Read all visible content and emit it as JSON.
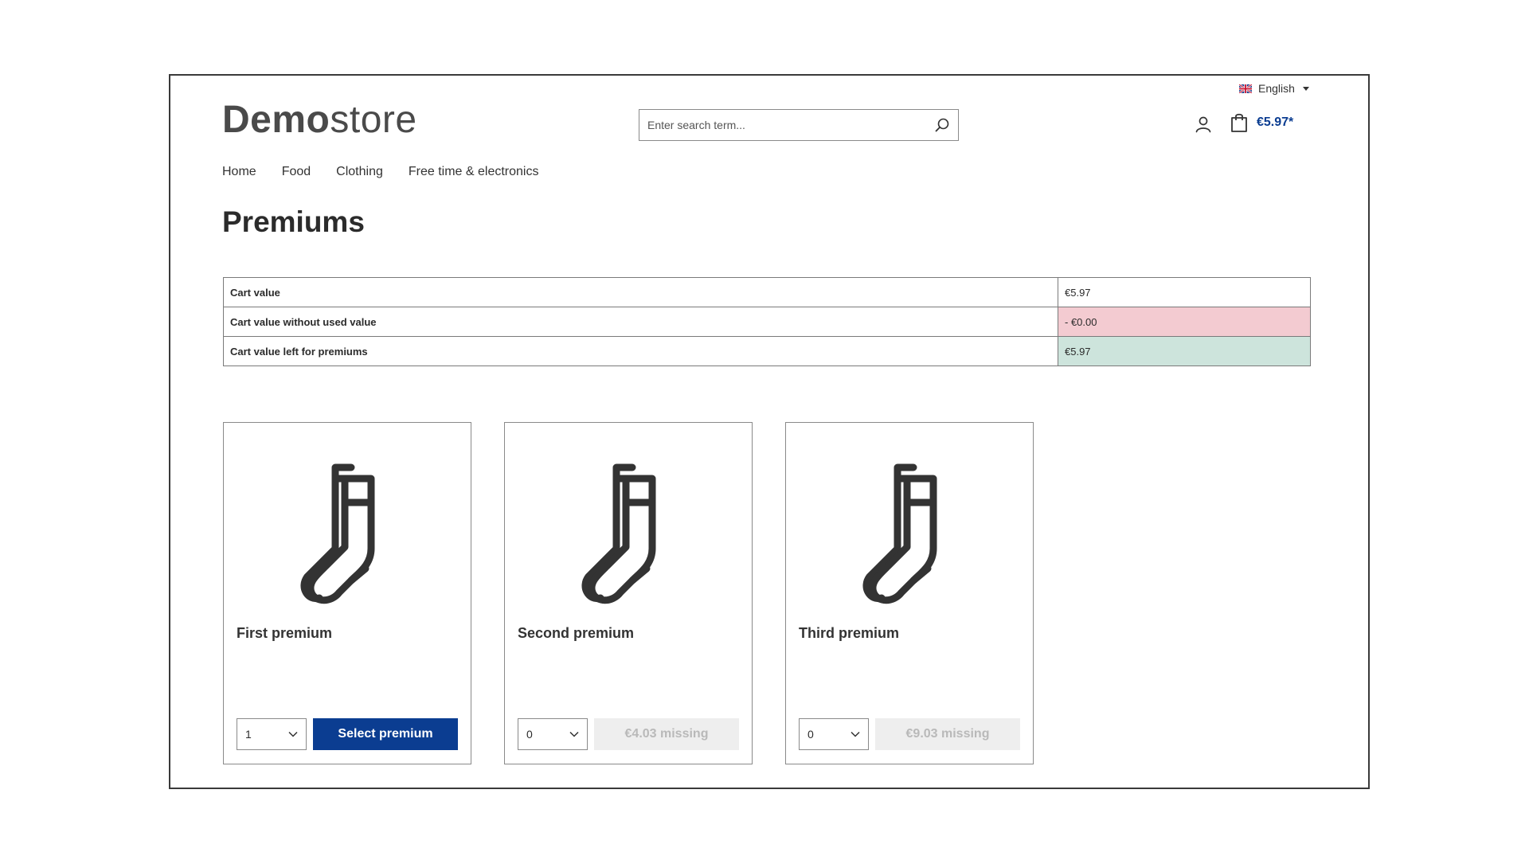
{
  "header": {
    "language": "English",
    "logo_bold": "Demo",
    "logo_light": "store",
    "search_placeholder": "Enter search term...",
    "cart_amount": "€5.97*"
  },
  "nav": {
    "items": [
      "Home",
      "Food",
      "Clothing",
      "Free time & electronics"
    ]
  },
  "page": {
    "title": "Premiums"
  },
  "summary": {
    "rows": [
      {
        "label": "Cart value",
        "value": "€5.97"
      },
      {
        "label": "Cart value without used value",
        "value": "- €0.00"
      },
      {
        "label": "Cart value left for premiums",
        "value": "€5.97"
      }
    ]
  },
  "premiums": [
    {
      "name": "First premium",
      "quantity": "1",
      "action": "Select premium"
    },
    {
      "name": "Second premium",
      "quantity": "0",
      "action": "€4.03 missing"
    },
    {
      "name": "Third premium",
      "quantity": "0",
      "action": "€9.03 missing"
    }
  ],
  "colors": {
    "accent": "#0b3d91",
    "negative_bg": "#f3cbd1",
    "positive_bg": "#cde4dc"
  },
  "icons": [
    "uk-flag-icon",
    "search-icon",
    "user-icon",
    "bag-icon",
    "socks-icon",
    "chevron-down-icon"
  ]
}
